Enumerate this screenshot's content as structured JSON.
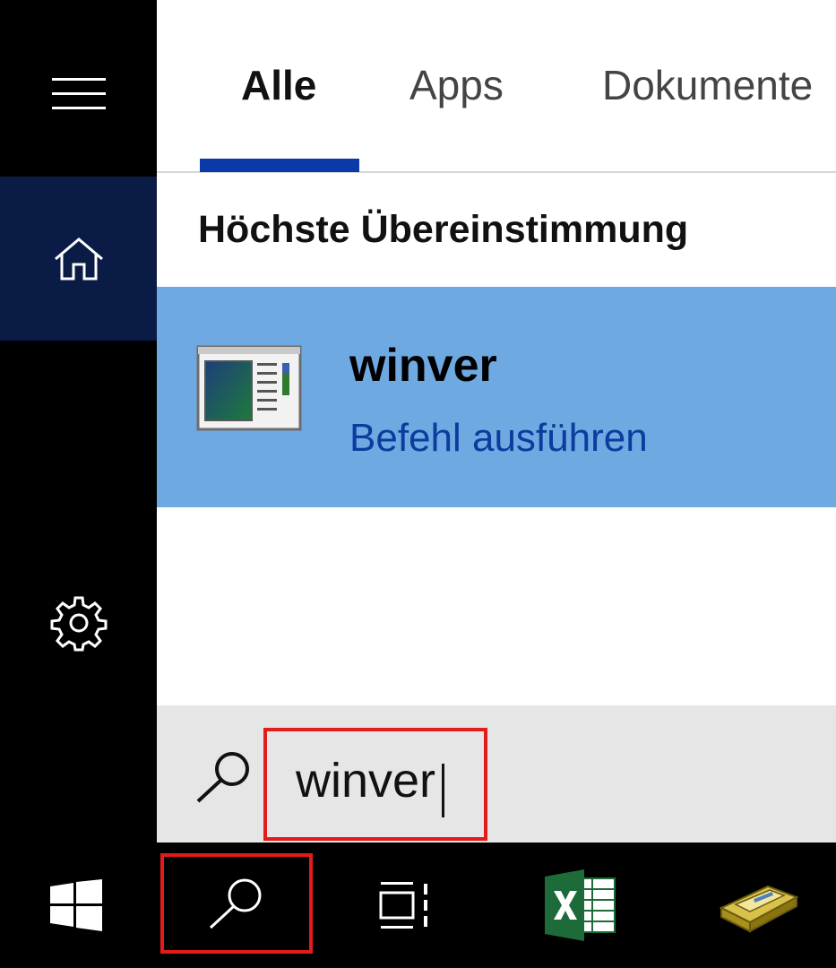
{
  "tabs": [
    {
      "label": "Alle",
      "active": true
    },
    {
      "label": "Apps",
      "active": false
    },
    {
      "label": "Dokumente",
      "active": false
    }
  ],
  "section_heading": "Höchste Übereinstimmung",
  "best_match": {
    "title": "winver",
    "subtitle": "Befehl ausführen",
    "icon": "run-command-window-icon"
  },
  "search": {
    "value": "winver"
  },
  "rail": {
    "items": [
      "hamburger-menu-icon",
      "home-icon",
      "settings-gear-icon"
    ]
  },
  "taskbar": {
    "items": [
      "windows-start-icon",
      "search-icon",
      "task-view-icon",
      "excel-icon",
      "file-cabinet-app-icon"
    ]
  },
  "colors": {
    "accent": "#0b3aa8",
    "selection": "#6fa9e2",
    "highlight_box": "#e21b1b",
    "home_active": "#0a1b45"
  }
}
